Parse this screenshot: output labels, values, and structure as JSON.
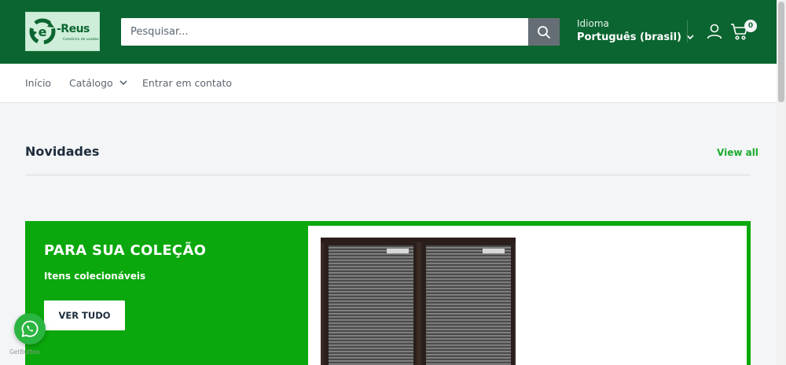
{
  "header": {
    "logo": {
      "text": "-Reus",
      "subtitle": "Comércio de usados"
    },
    "search": {
      "placeholder": "Pesquisar..."
    },
    "language": {
      "label": "Idioma",
      "value": "Português (brasil)"
    },
    "cart": {
      "count": "0"
    }
  },
  "nav": {
    "items": [
      {
        "label": "Início"
      },
      {
        "label": "Catálogo"
      },
      {
        "label": "Entrar em contato"
      }
    ]
  },
  "section": {
    "title": "Novidades",
    "view_all": "View all"
  },
  "promo": {
    "title": "PARA SUA COLEÇÃO",
    "subtitle": "Itens colecionáveis",
    "button": "VER TUDO"
  },
  "widget": {
    "credit": "GetButton"
  },
  "colors": {
    "header_bg": "#0b6530",
    "promo_bg": "#0aa80c",
    "link": "#1aaa2e",
    "page_bg": "#f3f5f6"
  }
}
